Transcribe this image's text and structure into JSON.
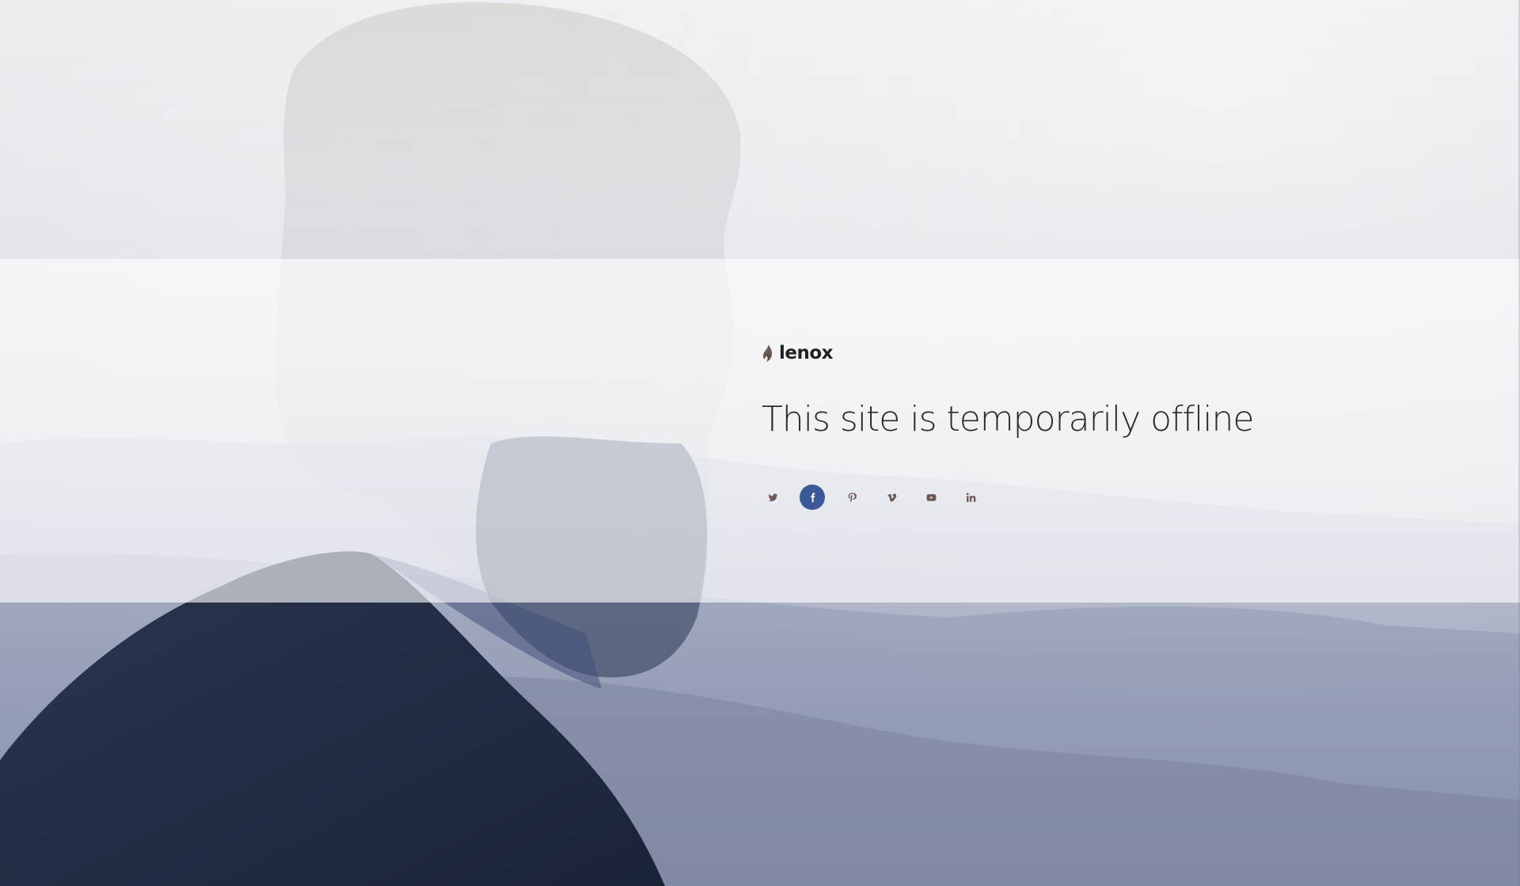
{
  "brand": {
    "name": "lenox",
    "accent_color": "#6e5a55"
  },
  "main": {
    "headline": "This site is temporarily offline"
  },
  "social_links": [
    {
      "name": "twitter-icon",
      "active": false
    },
    {
      "name": "facebook-icon",
      "active": true,
      "color": "#3b5998"
    },
    {
      "name": "pinterest-icon",
      "active": false
    },
    {
      "name": "vimeo-icon",
      "active": false
    },
    {
      "name": "youtube-icon",
      "active": false
    },
    {
      "name": "linkedin-icon",
      "active": false
    }
  ],
  "colors": {
    "band": "rgba(255,255,255,0.62)",
    "text": "#2b2b2f",
    "icon": "#6e5a55",
    "facebook": "#3b5998"
  }
}
